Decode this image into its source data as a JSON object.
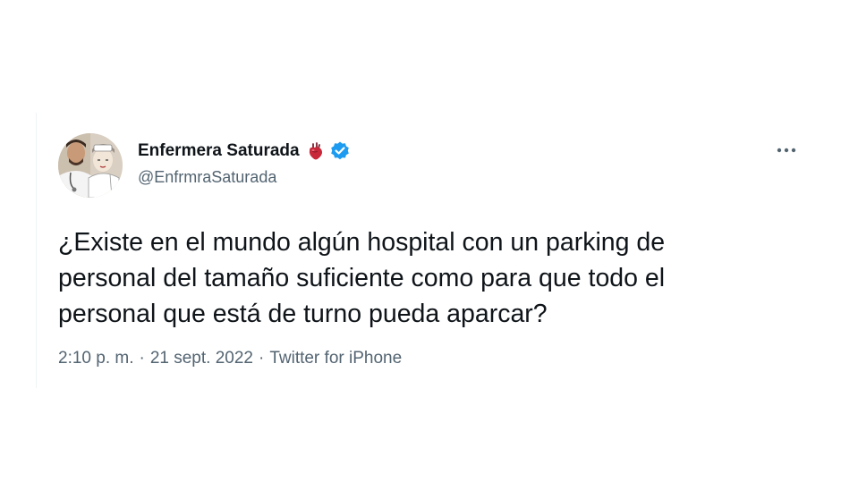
{
  "tweet": {
    "author": {
      "display_name": "Enfermera Saturada",
      "handle": "@EnfrmraSaturada",
      "emoji_icon": "anatomical-heart-icon",
      "verified_icon": "verified-badge-icon",
      "avatar_icon": "avatar-image"
    },
    "more_icon": "more-options-icon",
    "text_lines": [
      "¿Existe en el mundo algún hospital con un parking de",
      "personal del tamaño suficiente como para que todo el",
      "personal que está de turno pueda aparcar?"
    ],
    "meta": {
      "time": "2:10 p. m.",
      "separator": "·",
      "date": "21 sept. 2022",
      "source": "Twitter for iPhone"
    }
  },
  "colors": {
    "text_primary": "#0f1419",
    "text_secondary": "#536471",
    "verified_blue": "#1d9bf0",
    "heart_red": "#c8283a"
  }
}
